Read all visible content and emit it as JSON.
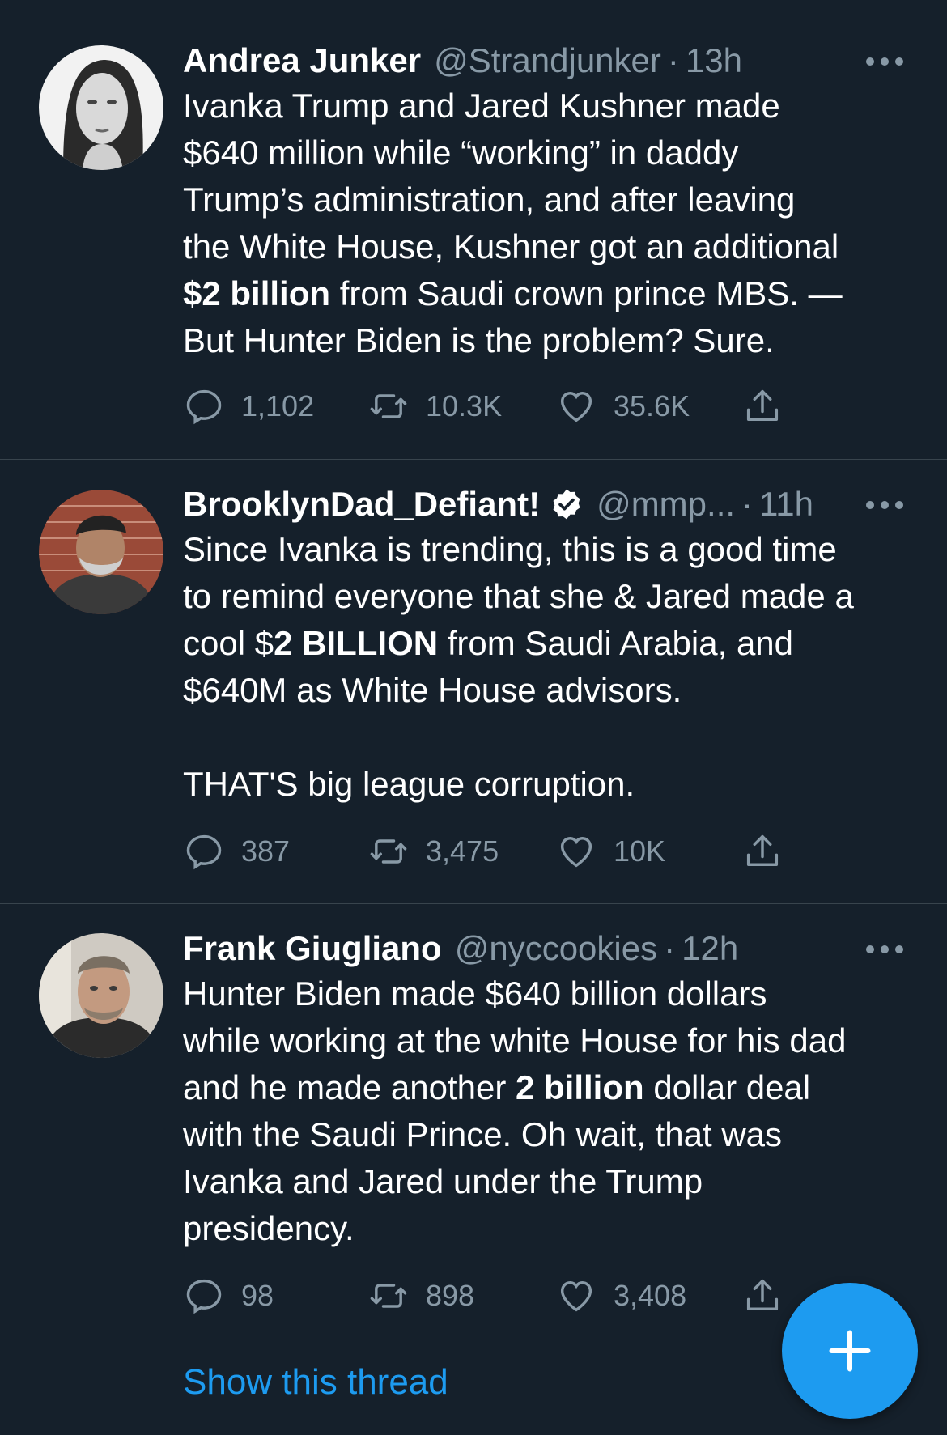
{
  "colors": {
    "background": "#15202b",
    "divider": "#38444d",
    "secondary_text": "#8899a6",
    "accent": "#1d9bf0"
  },
  "tweets": [
    {
      "name": "Andrea Junker",
      "handle": "@Strandjunker",
      "dot": "·",
      "time": "13h",
      "verified": false,
      "body_parts": [
        "Ivanka Trump and Jared Kushner made\n$640 million while “working” in daddy\nTrump’s administration, and after leaving\nthe White House, Kushner got an additional\n",
        "$",
        "2 billion",
        " from Saudi crown prince MBS. —\nBut Hunter Biden is the problem? Sure."
      ],
      "replies": "1,102",
      "retweets": "10.3K",
      "likes": "35.6K",
      "avatar_icon": "avatar-woman-bw"
    },
    {
      "name": "BrooklynDad_Defiant!",
      "handle": "@mmp...",
      "dot": "·",
      "time": "11h",
      "verified": true,
      "body_parts": [
        "Since Ivanka is trending, this is a good time\nto remind everyone that she & Jared made a\ncool $",
        "2 BILLION",
        " from Saudi Arabia, and\n$640M as White House advisors.\n\nTHAT'S big league corruption."
      ],
      "replies": "387",
      "retweets": "3,475",
      "likes": "10K",
      "avatar_icon": "avatar-man-beanie"
    },
    {
      "name": "Frank Giugliano",
      "handle": "@nyccookies",
      "dot": "·",
      "time": "12h",
      "verified": false,
      "body_parts": [
        "Hunter Biden made $640 billion dollars\nwhile working at the white House for his dad\nand he made another ",
        "2 billion",
        " dollar deal\nwith the Saudi Prince. Oh wait, that was\nIvanka and Jared under the Trump\npresidency."
      ],
      "replies": "98",
      "retweets": "898",
      "likes": "3,408",
      "avatar_icon": "avatar-man-selfie"
    }
  ],
  "show_thread_label": "Show this thread",
  "fab_icon": "plus-icon"
}
